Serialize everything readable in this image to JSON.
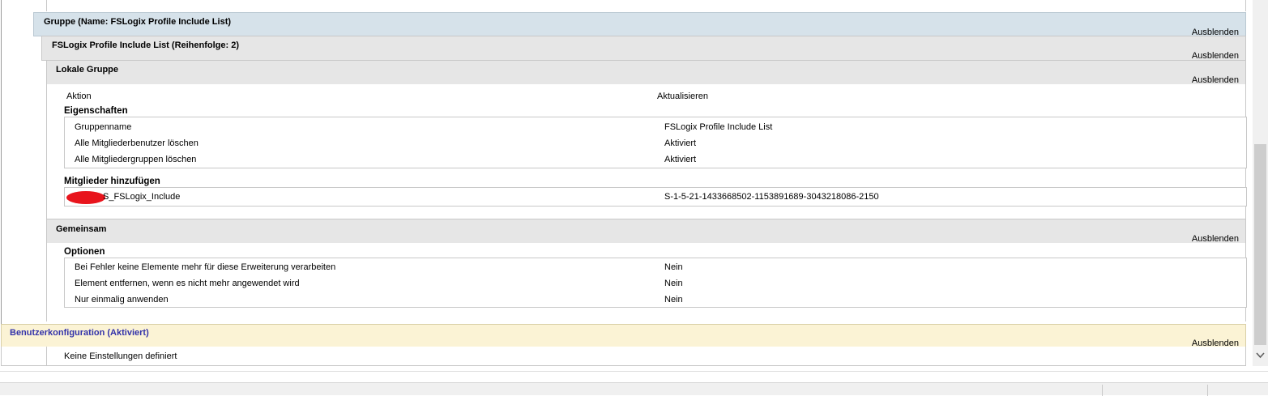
{
  "group_header": {
    "title": "Gruppe (Name: FSLogix Profile Include List)",
    "hide": "Ausblenden"
  },
  "item_header": {
    "title": "FSLogix Profile Include List (Reihenfolge: 2)",
    "hide": "Ausblenden"
  },
  "local_group": {
    "title": "Lokale Gruppe",
    "hide": "Ausblenden",
    "action_label": "Aktion",
    "action_value": "Aktualisieren",
    "properties_title": "Eigenschaften",
    "properties": [
      {
        "label": "Gruppenname",
        "value": "FSLogix Profile Include List"
      },
      {
        "label": "Alle Mitgliederbenutzer löschen",
        "value": "Aktiviert"
      },
      {
        "label": "Alle Mitgliedergruppen löschen",
        "value": "Aktiviert"
      }
    ],
    "members_title": "Mitglieder hinzufügen",
    "members": [
      {
        "name": "S_FSLogix_Include",
        "sid": "S-1-5-21-1433668502-1153891689-3043218086-2150"
      }
    ]
  },
  "common": {
    "title": "Gemeinsam",
    "hide": "Ausblenden",
    "options_title": "Optionen",
    "options": [
      {
        "label": "Bei Fehler keine Elemente mehr für diese Erweiterung verarbeiten",
        "value": "Nein"
      },
      {
        "label": "Element entfernen, wenn es nicht mehr angewendet wird",
        "value": "Nein"
      },
      {
        "label": "Nur einmalig anwenden",
        "value": "Nein"
      }
    ]
  },
  "user_config": {
    "title": "Benutzerkonfiguration (Aktiviert)",
    "hide": "Ausblenden",
    "empty_text": "Keine Einstellungen definiert"
  },
  "colors": {
    "group_header_bg": "#d6e2ea",
    "gray_header_bg": "#e6e6e6",
    "user_config_bg": "#fbf3d5",
    "user_config_text": "#3333aa"
  }
}
